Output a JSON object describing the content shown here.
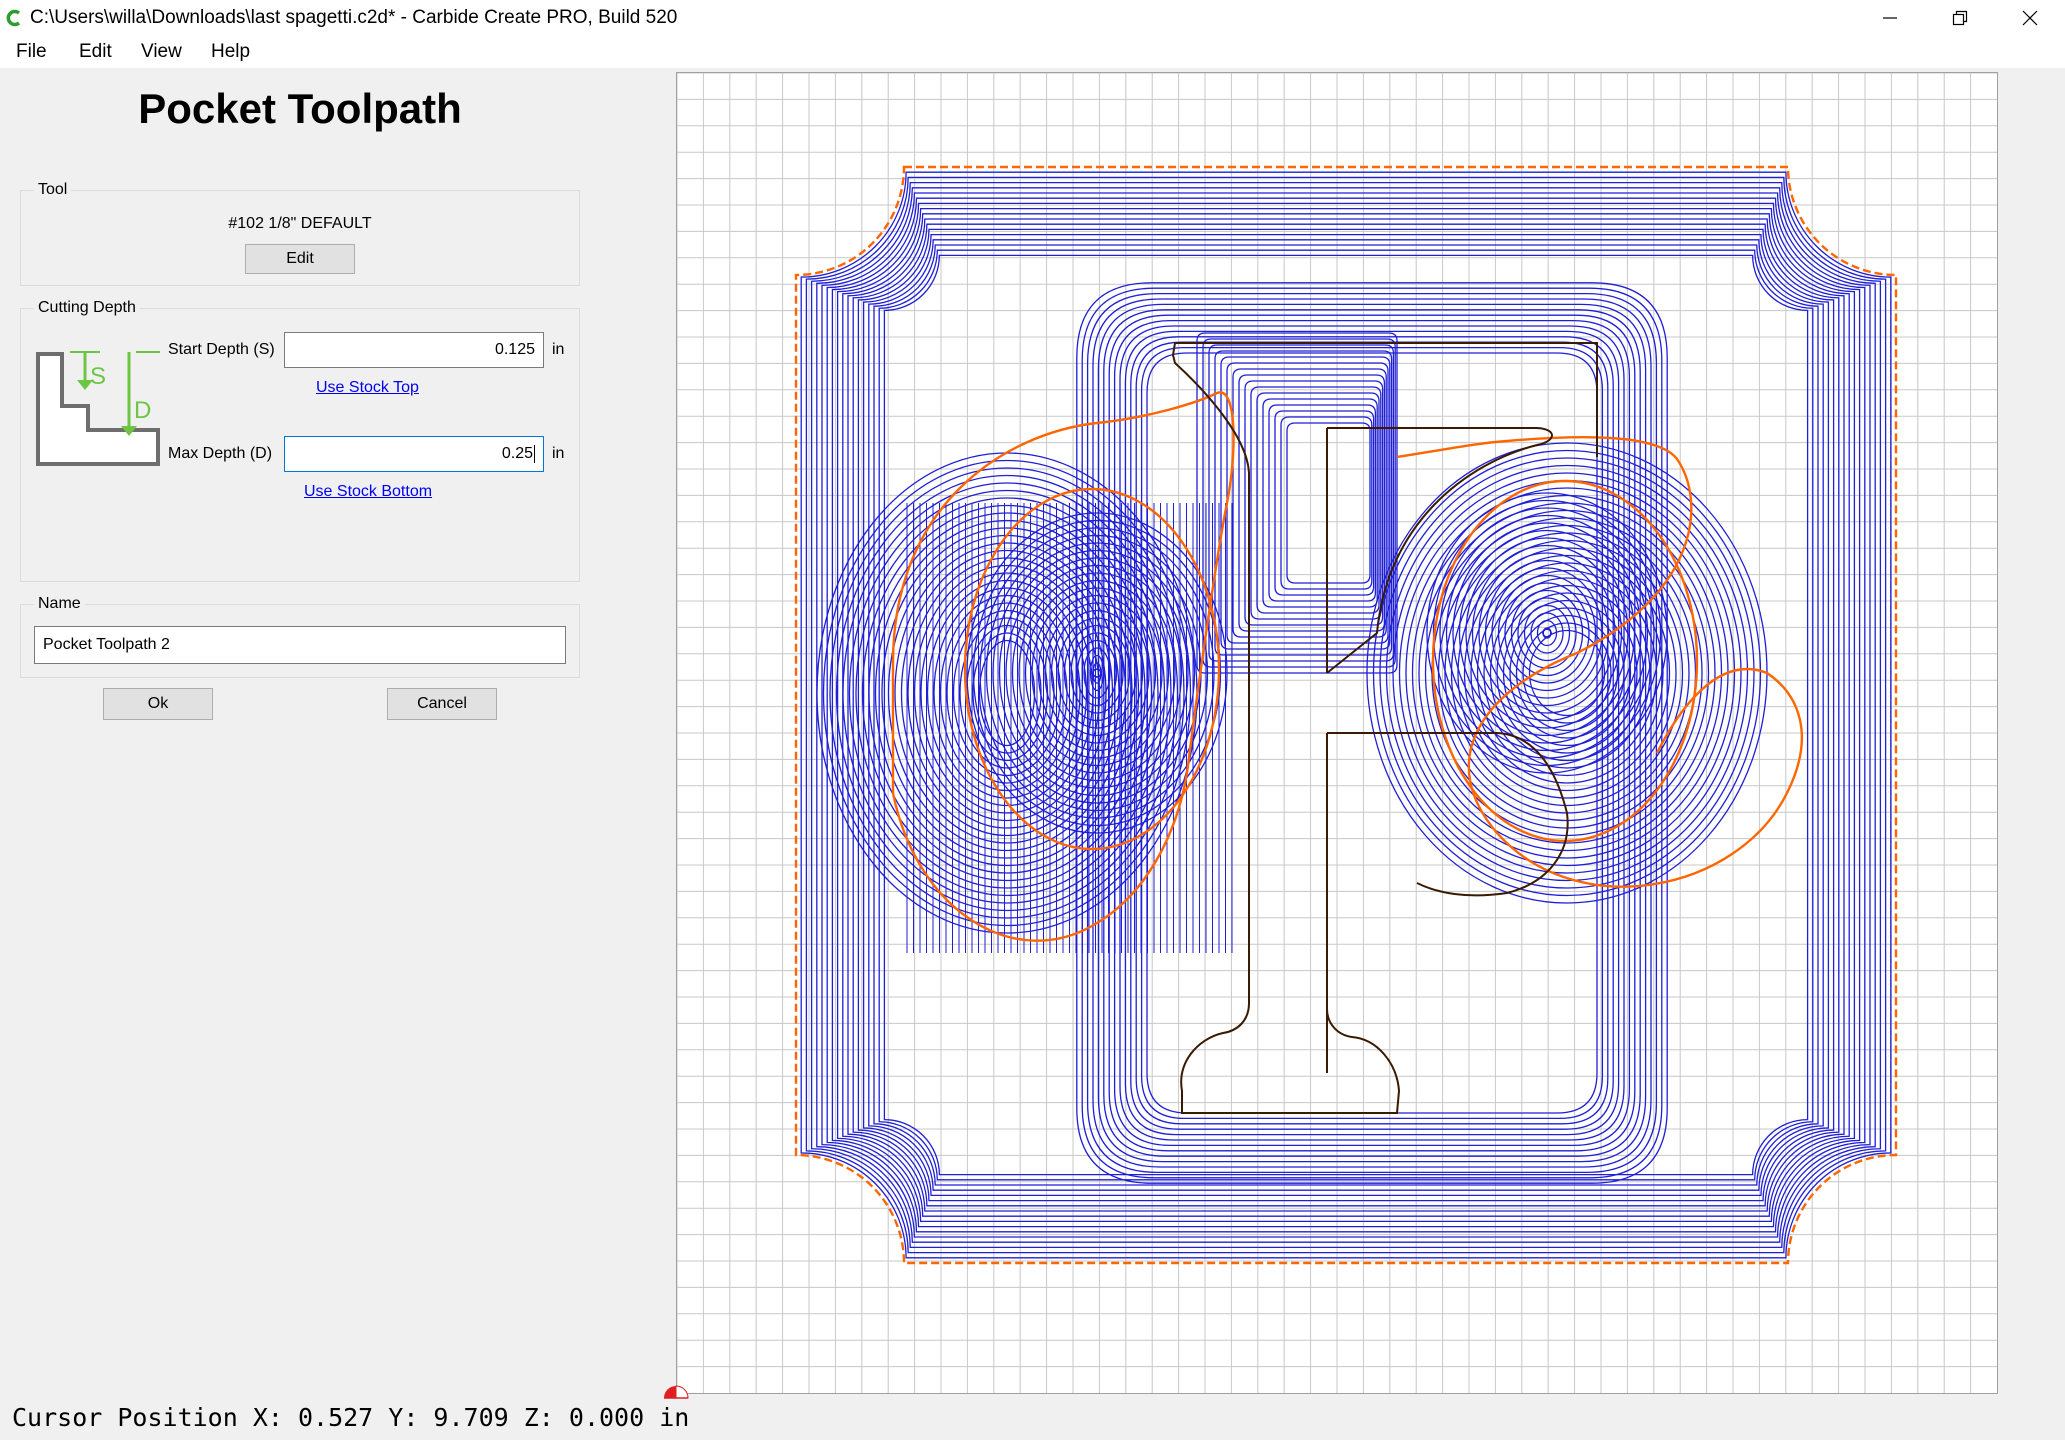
{
  "window": {
    "title": "C:\\Users\\willa\\Downloads\\last spagetti.c2d* - Carbide Create PRO, Build 520",
    "controls": [
      "minimize",
      "restore",
      "close"
    ]
  },
  "menu": {
    "file": "File",
    "edit": "Edit",
    "view": "View",
    "help": "Help"
  },
  "panel": {
    "title": "Pocket Toolpath",
    "tool": {
      "group_label": "Tool",
      "name": "#102 1/8\" DEFAULT",
      "edit_label": "Edit"
    },
    "cutting_depth": {
      "group_label": "Cutting Depth",
      "diagram_s": "S",
      "diagram_d": "D",
      "start_label": "Start Depth (S)",
      "start_value": "0.125",
      "start_unit": "in",
      "use_stock_top": "Use Stock Top",
      "max_label": "Max Depth (D)",
      "max_value": "0.25",
      "max_unit": "in",
      "use_stock_bottom": "Use Stock Bottom"
    },
    "name": {
      "group_label": "Name",
      "value": "Pocket Toolpath 2"
    },
    "ok_label": "Ok",
    "cancel_label": "Cancel"
  },
  "colors": {
    "toolpath": "#1f1fd6",
    "boundary": "#ff6600",
    "vector": "#3a1a00",
    "grid": "#c8c8c8",
    "diagram_green": "#6cc644"
  },
  "status": {
    "text": "Cursor Position X: 0.527 Y: 9.709 Z: 0.000 in"
  }
}
